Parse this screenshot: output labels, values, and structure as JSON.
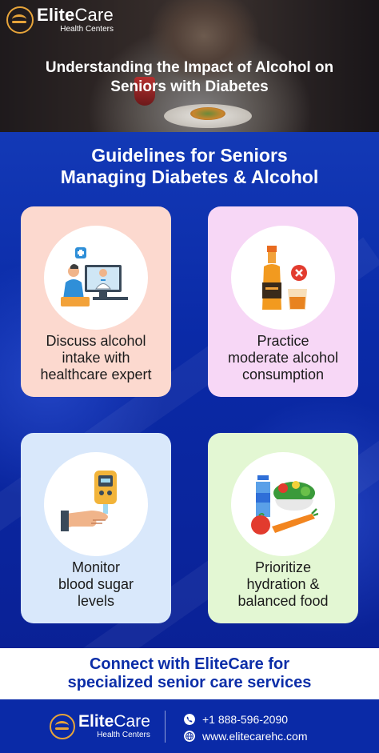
{
  "header": {
    "brand_elite": "Elite",
    "brand_care": "Care",
    "brand_sub": "Health Centers",
    "title_line1": "Understanding the Impact of Alcohol on",
    "title_line2": "Seniors with Diabetes"
  },
  "guidelines": {
    "title_line1": "Guidelines for Seniors",
    "title_line2": "Managing Diabetes & Alcohol",
    "cards": [
      {
        "icon": "healthcare-consultation-icon",
        "line1": "Discuss alcohol",
        "line2": "intake with",
        "line3": "healthcare expert"
      },
      {
        "icon": "alcohol-bottle-icon",
        "line1": "Practice",
        "line2": "moderate alcohol",
        "line3": "consumption"
      },
      {
        "icon": "glucose-meter-icon",
        "line1": "Monitor",
        "line2": "blood sugar",
        "line3": "levels"
      },
      {
        "icon": "healthy-food-icon",
        "line1": "Prioritize",
        "line2": "hydration &",
        "line3": "balanced food"
      }
    ]
  },
  "cta": {
    "line1": "Connect with EliteCare for",
    "line2": "specialized senior care services"
  },
  "footer": {
    "brand_elite": "Elite",
    "brand_care": "Care",
    "brand_sub": "Health Centers",
    "phone": "+1 888-596-2090",
    "website": "www.elitecarehc.com"
  },
  "colors": {
    "brand_blue": "#0a2aa7",
    "accent_gold": "#e7a43a",
    "card1_bg": "#fcd9cf",
    "card2_bg": "#f7d7f6",
    "card3_bg": "#d9e8fb",
    "card4_bg": "#e3f7d3"
  }
}
